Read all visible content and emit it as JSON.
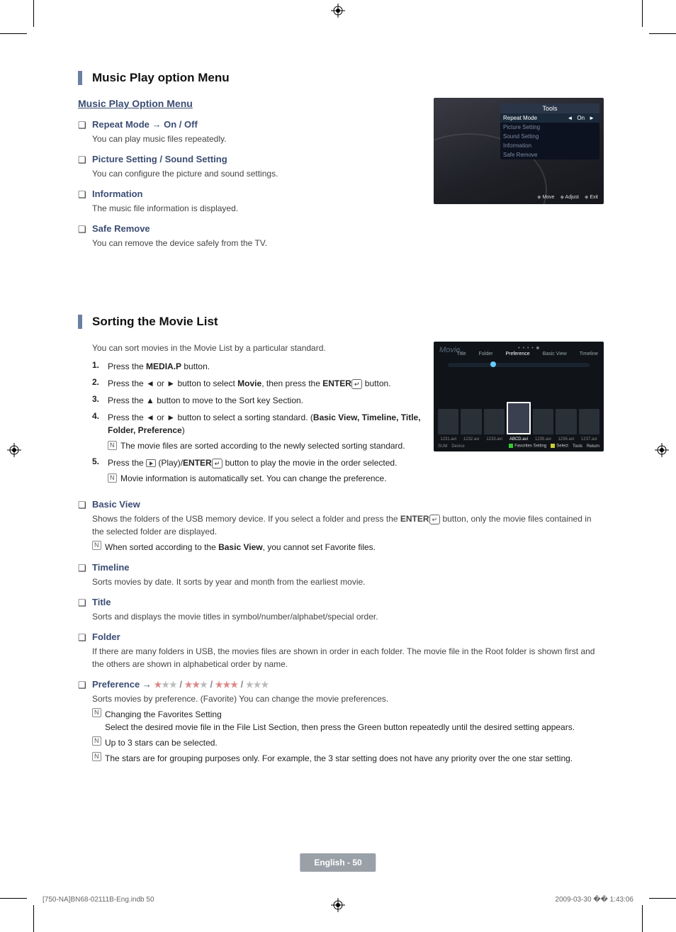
{
  "section1": {
    "heading": "Music Play option Menu",
    "subhead": "Music Play Option Menu",
    "items": [
      {
        "title": "Repeat Mode → On / Off",
        "desc": "You can play music files repeatedly."
      },
      {
        "title": "Picture Setting / Sound Setting",
        "desc": "You can configure the picture and sound settings."
      },
      {
        "title": "Information",
        "desc": "The music file information is displayed."
      },
      {
        "title": "Safe Remove",
        "desc": "You can remove the device safely from the TV."
      }
    ]
  },
  "tools_shot": {
    "title": "Tools",
    "rows": [
      {
        "label": "Repeat Mode",
        "value": "On",
        "sel": true
      },
      {
        "label": "Picture Setting"
      },
      {
        "label": "Sound Setting"
      },
      {
        "label": "Information"
      },
      {
        "label": "Safe Remove"
      }
    ],
    "footer": [
      "Move",
      "Adjust",
      "Exit"
    ]
  },
  "section2": {
    "heading": "Sorting the Movie List",
    "intro": "You can sort movies in the Movie List by a particular standard.",
    "steps": {
      "s1": "Press the ",
      "s1b": "MEDIA.P",
      "s1c": " button.",
      "s2a": "Press the ◄ or ► button to select ",
      "s2b": "Movie",
      "s2c": ", then press the ",
      "s2d": "ENTER",
      "s2e": " button.",
      "s3": "Press the ▲ button to move to the Sort key Section.",
      "s4a": "Press the ◄ or ► button to select a sorting standard. (",
      "s4b": "Basic View, Timeline, Title, Folder, Preference",
      "s4c": ")",
      "s4n": "The movie files are sorted according to the newly selected sorting standard.",
      "s5a": "Press the ",
      "s5b": " (Play)/",
      "s5c": "ENTER",
      "s5d": " button to play the movie in the order selected.",
      "s5n": "Movie information is automatically set. You can change the preference."
    },
    "basic": {
      "title": "Basic View",
      "d1": "Shows the folders of the USB memory device. If you select a folder and press the ",
      "d1b": "ENTER",
      "d1c": " button, only the movie files contained in the selected folder are displayed.",
      "n1a": "When sorted according to the ",
      "n1b": "Basic View",
      "n1c": ", you cannot set Favorite files."
    },
    "timeline": {
      "title": "Timeline",
      "desc": "Sorts movies by date. It sorts by year and month from the earliest movie."
    },
    "titleSort": {
      "title": "Title",
      "desc": "Sorts and displays the movie titles in symbol/number/alphabet/special order."
    },
    "folder": {
      "title": "Folder",
      "desc": "If there are many folders in USB, the movies files are shown in order in each folder. The movie file in the Root folder is shown first and the others are shown in alphabetical order by name."
    },
    "pref": {
      "title": "Preference → ",
      "desc": "Sorts movies by preference. (Favorite) You can change the movie preferences.",
      "n1": "Changing the Favorites Setting",
      "n1b": "Select the desired movie file in the File List Section, then press the Green button repeatedly until the desired setting appears.",
      "n2": "Up to 3 stars can be selected.",
      "n3": "The stars are for grouping purposes only. For example, the 3 star setting does not have any priority over the one star setting."
    }
  },
  "movie_shot": {
    "overlay": "Movie",
    "tabs": [
      "Title",
      "Folder",
      "Preference",
      "Basic View",
      "Timeline"
    ],
    "sel_tab": 2,
    "thumbs": [
      "1231.avi",
      "1232.avi",
      "1233.avi",
      "ABCD.avi",
      "1235.avi",
      "1236.avi",
      "1237.avi"
    ],
    "sel_thumb": 3,
    "footer_left": [
      "SUM",
      "Device"
    ],
    "footer_right": [
      "Favorites Setting",
      "Select",
      "Tools",
      "Return"
    ]
  },
  "footer": {
    "pill": "English - 50",
    "left": "[750-NA]BN68-02111B-Eng.indb   50",
    "right": "2009-03-30   �� 1:43:06"
  }
}
